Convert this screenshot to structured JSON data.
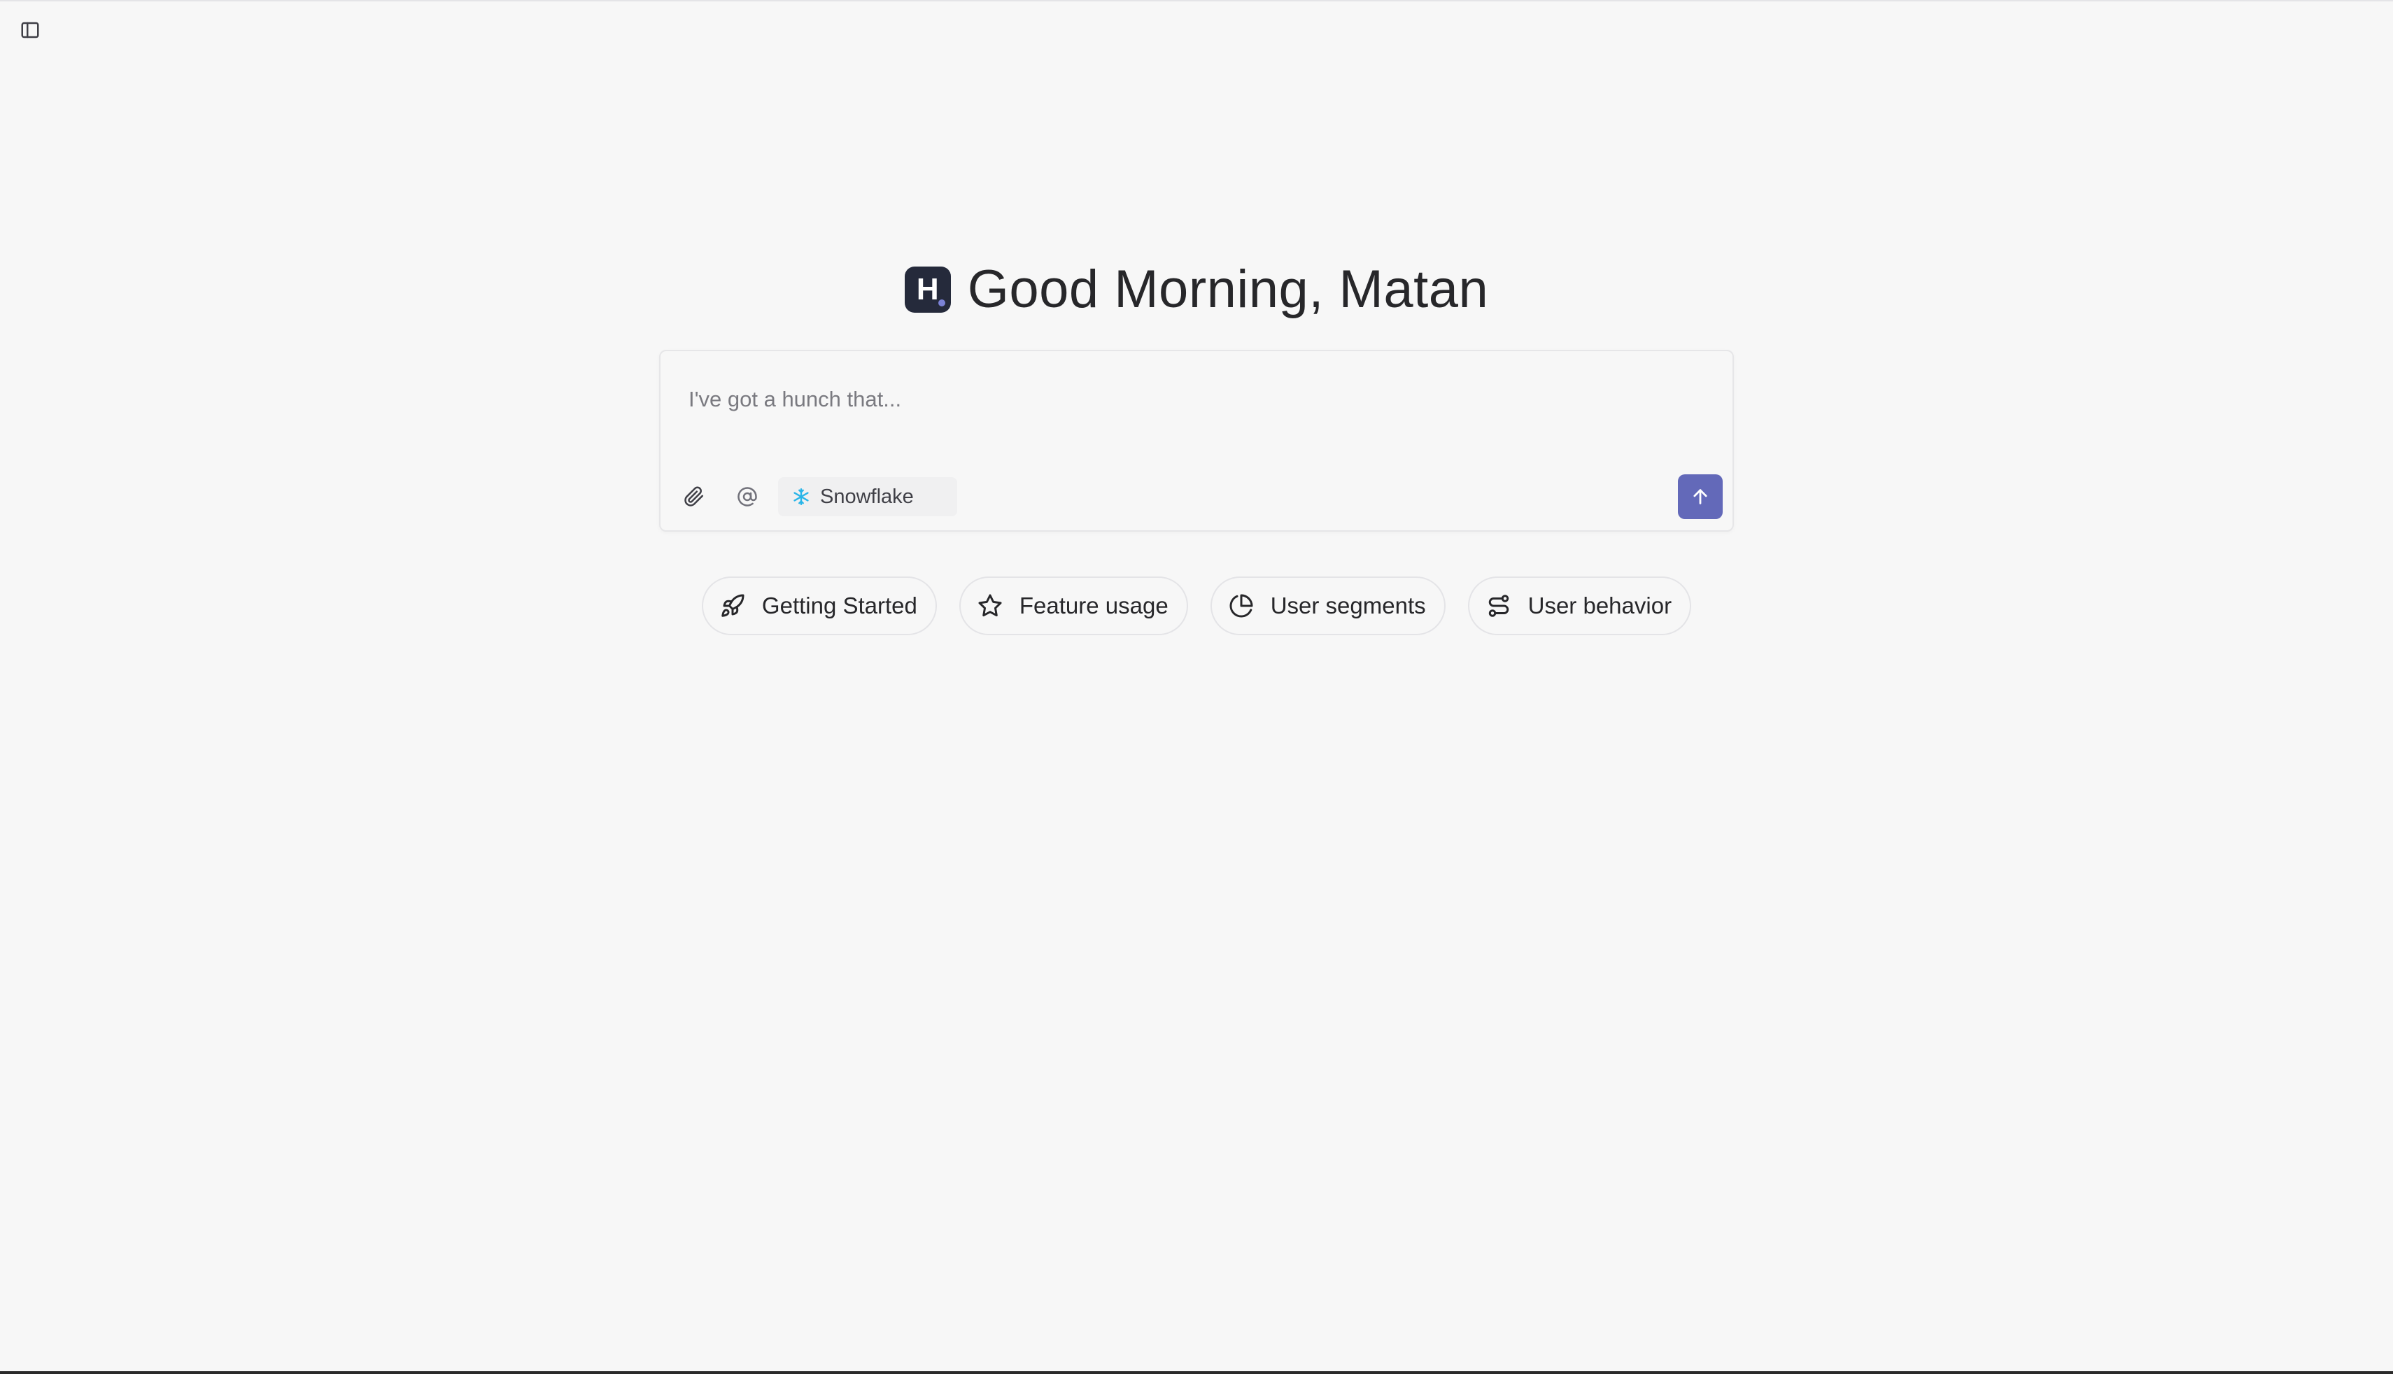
{
  "greeting": {
    "logo_letter": "H",
    "text": "Good Morning, Matan"
  },
  "composer": {
    "placeholder": "I've got a hunch that...",
    "value": "",
    "source": {
      "label": "Snowflake",
      "icon": "snowflake-icon",
      "icon_color": "#29b5e8"
    },
    "send_color": "#6369b9"
  },
  "suggestions": [
    {
      "label": "Getting Started",
      "icon": "rocket-icon"
    },
    {
      "label": "Feature usage",
      "icon": "star-icon"
    },
    {
      "label": "User segments",
      "icon": "pie-chart-icon"
    },
    {
      "label": "User behavior",
      "icon": "workflow-icon"
    }
  ],
  "icons": {
    "sidebar_toggle": "sidebar-panel-icon",
    "attach": "paperclip-icon",
    "mention": "at-sign-icon",
    "send": "arrow-up-icon"
  }
}
